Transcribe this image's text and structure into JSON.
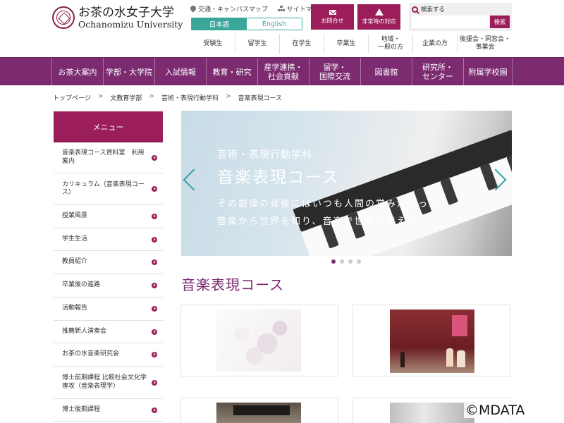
{
  "header": {
    "university_ja": "お茶の水女子大学",
    "university_en": "Ochanomizu University",
    "top_links": [
      "交通・キャンパスマップ",
      "サイトマップ"
    ],
    "lang_ja": "日本語",
    "lang_en": "English",
    "contact_label": "お問合せ",
    "emergency_label": "非常時の対応",
    "search_label": "検索する",
    "search_button": "検索",
    "search_value": "",
    "audience": [
      "受験生",
      "留学生",
      "在学生",
      "卒業生",
      "地域・\n一般の方",
      "企業の方",
      "後援会・同窓会・\n事業会"
    ]
  },
  "nav": {
    "items": [
      "お茶大案内",
      "学部・大学院",
      "入試情報",
      "教育・研究",
      "産学連携・\n社会貢献",
      "留学・\n国際交流",
      "図書館",
      "研究所・\nセンター",
      "附属学校園"
    ]
  },
  "breadcrumb": {
    "items": [
      "トップページ",
      "文教育学部",
      "芸術・表現行動学科",
      "音楽表現コース"
    ],
    "separator": ">"
  },
  "sidebar": {
    "title": "メニュー",
    "items": [
      "音楽表現コース資料室　利用案内",
      "カリキュラム（音楽表現コース）",
      "授業風景",
      "学生生活",
      "教員紹介",
      "卒業後の進路",
      "活動報告",
      "推薦新人演奏会",
      "お茶の水音楽研究会",
      "博士前期課程 比較社会文化学専攻（音楽表現学）",
      "博士後期課程"
    ]
  },
  "hero": {
    "subtitle": "芸術・表現行動学科",
    "title": "音楽表現コース",
    "line1": "その旋律の背後にはいつも人間の営みがあった",
    "line2": "音楽から世界を知り、音楽で世界を考える",
    "slide_count": 4,
    "active_slide": 1
  },
  "main": {
    "section_title": "音楽表現コース"
  },
  "watermark": "©MDATA",
  "colors": {
    "brand": "#9b1e5a",
    "nav_bg": "#7c2b71",
    "accent_teal": "#3aa79a"
  }
}
